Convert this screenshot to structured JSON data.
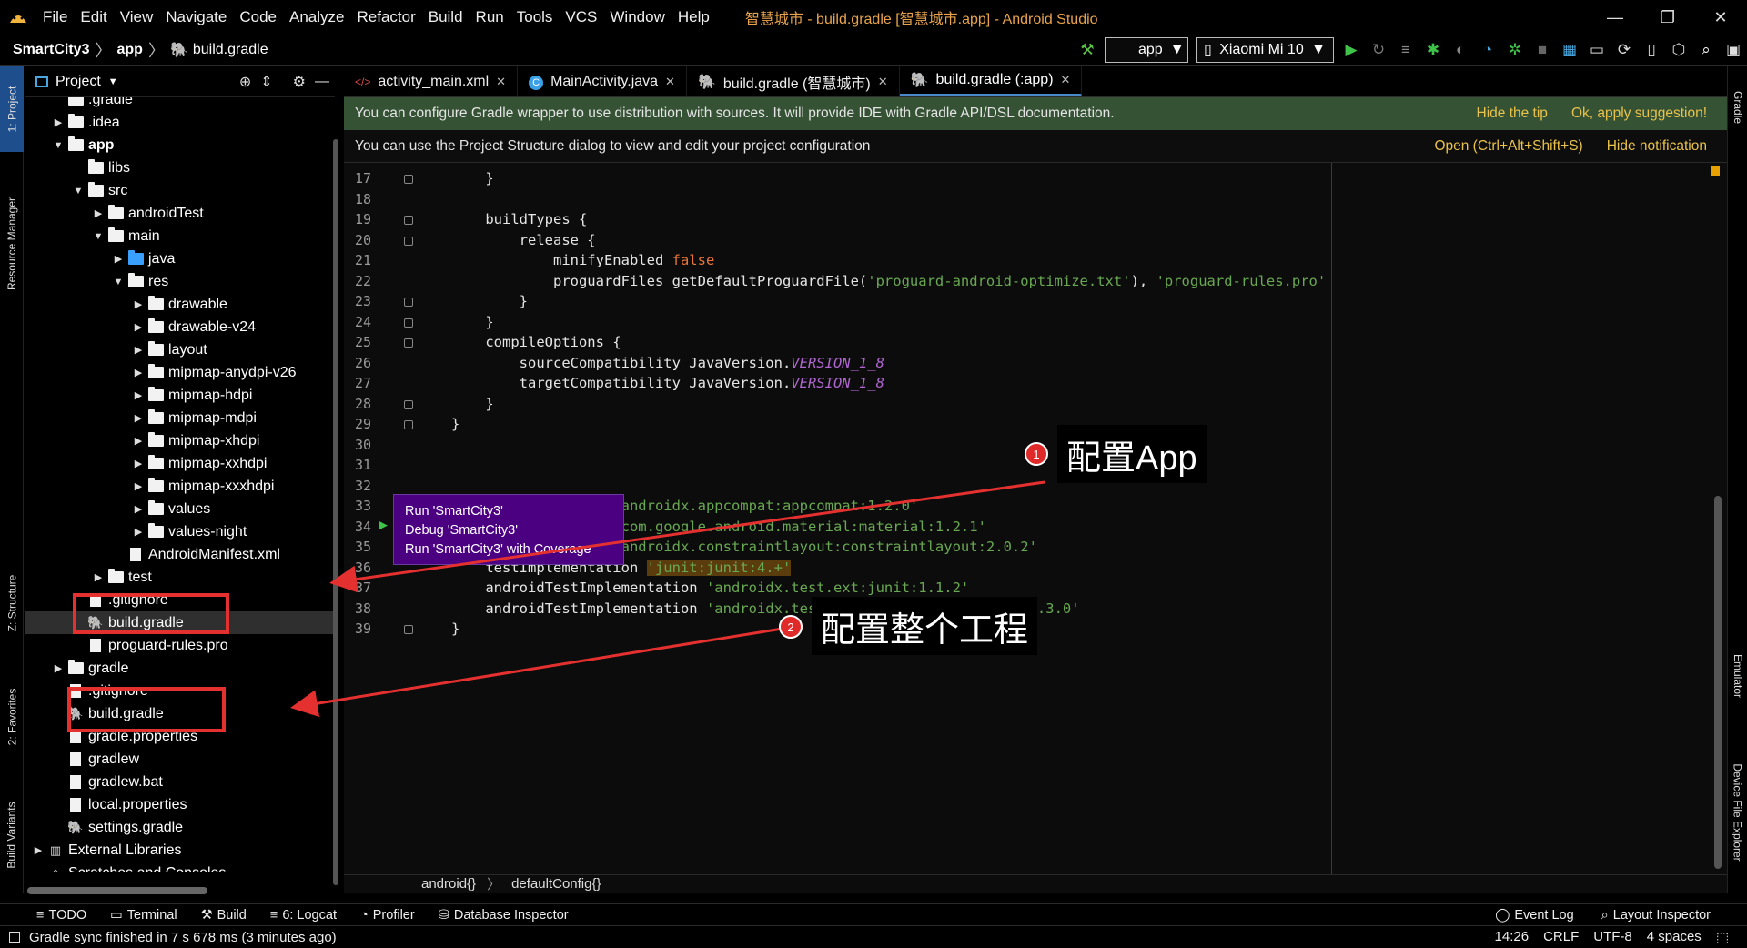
{
  "menu": {
    "items": [
      "File",
      "Edit",
      "View",
      "Navigate",
      "Code",
      "Analyze",
      "Refactor",
      "Build",
      "Run",
      "Tools",
      "VCS",
      "Window",
      "Help"
    ],
    "window_title": "智慧城市 - build.gradle [智慧城市.app] - Android Studio"
  },
  "nav": {
    "project": "SmartCity3",
    "module": "app",
    "file": "build.gradle",
    "run_config": "app",
    "device": "Xiaomi Mi 10"
  },
  "side_tabs": {
    "project": "1: Project",
    "resource_manager": "Resource Manager",
    "structure": "Z: Structure",
    "favorites": "2: Favorites",
    "build_variants": "Build Variants",
    "gradle": "Gradle",
    "emulator": "Emulator",
    "device_file_explorer": "Device File Explorer"
  },
  "project_panel": {
    "title": "Project",
    "tree": [
      {
        "label": ".gradle",
        "depth": 1,
        "arrow": "",
        "icon": "folder"
      },
      {
        "label": ".idea",
        "depth": 1,
        "arrow": "▶",
        "icon": "folder"
      },
      {
        "label": "app",
        "depth": 1,
        "arrow": "▼",
        "icon": "folder",
        "bold": true
      },
      {
        "label": "libs",
        "depth": 2,
        "arrow": "",
        "icon": "folder"
      },
      {
        "label": "src",
        "depth": 2,
        "arrow": "▼",
        "icon": "folder"
      },
      {
        "label": "androidTest",
        "depth": 3,
        "arrow": "▶",
        "icon": "folder"
      },
      {
        "label": "main",
        "depth": 3,
        "arrow": "▼",
        "icon": "folder"
      },
      {
        "label": "java",
        "depth": 4,
        "arrow": "▶",
        "icon": "folder-blue"
      },
      {
        "label": "res",
        "depth": 4,
        "arrow": "▼",
        "icon": "folder"
      },
      {
        "label": "drawable",
        "depth": 5,
        "arrow": "▶",
        "icon": "folder"
      },
      {
        "label": "drawable-v24",
        "depth": 5,
        "arrow": "▶",
        "icon": "folder"
      },
      {
        "label": "layout",
        "depth": 5,
        "arrow": "▶",
        "icon": "folder"
      },
      {
        "label": "mipmap-anydpi-v26",
        "depth": 5,
        "arrow": "▶",
        "icon": "folder"
      },
      {
        "label": "mipmap-hdpi",
        "depth": 5,
        "arrow": "▶",
        "icon": "folder"
      },
      {
        "label": "mipmap-mdpi",
        "depth": 5,
        "arrow": "▶",
        "icon": "folder"
      },
      {
        "label": "mipmap-xhdpi",
        "depth": 5,
        "arrow": "▶",
        "icon": "folder"
      },
      {
        "label": "mipmap-xxhdpi",
        "depth": 5,
        "arrow": "▶",
        "icon": "folder"
      },
      {
        "label": "mipmap-xxxhdpi",
        "depth": 5,
        "arrow": "▶",
        "icon": "folder"
      },
      {
        "label": "values",
        "depth": 5,
        "arrow": "▶",
        "icon": "folder"
      },
      {
        "label": "values-night",
        "depth": 5,
        "arrow": "▶",
        "icon": "folder"
      },
      {
        "label": "AndroidManifest.xml",
        "depth": 4,
        "arrow": "",
        "icon": "file"
      },
      {
        "label": "test",
        "depth": 3,
        "arrow": "▶",
        "icon": "folder"
      },
      {
        "label": ".gitignore",
        "depth": 2,
        "arrow": "",
        "icon": "file"
      },
      {
        "label": "build.gradle",
        "depth": 2,
        "arrow": "",
        "icon": "gradle",
        "selected": true
      },
      {
        "label": "proguard-rules.pro",
        "depth": 2,
        "arrow": "",
        "icon": "file"
      },
      {
        "label": "gradle",
        "depth": 1,
        "arrow": "▶",
        "icon": "folder"
      },
      {
        "label": ".gitignore",
        "depth": 1,
        "arrow": "",
        "icon": "file"
      },
      {
        "label": "build.gradle",
        "depth": 1,
        "arrow": "",
        "icon": "gradle"
      },
      {
        "label": "gradle.properties",
        "depth": 1,
        "arrow": "",
        "icon": "file"
      },
      {
        "label": "gradlew",
        "depth": 1,
        "arrow": "",
        "icon": "file"
      },
      {
        "label": "gradlew.bat",
        "depth": 1,
        "arrow": "",
        "icon": "file"
      },
      {
        "label": "local.properties",
        "depth": 1,
        "arrow": "",
        "icon": "file"
      },
      {
        "label": "settings.gradle",
        "depth": 1,
        "arrow": "",
        "icon": "gradle"
      },
      {
        "label": "External Libraries",
        "depth": 0,
        "arrow": "▶",
        "icon": "library"
      },
      {
        "label": "Scratches and Consoles",
        "depth": 0,
        "arrow": "",
        "icon": "scratch"
      }
    ]
  },
  "editor": {
    "tabs": [
      {
        "label": "activity_main.xml",
        "icon": "xml"
      },
      {
        "label": "MainActivity.java",
        "icon": "class"
      },
      {
        "label": "build.gradle (智慧城市)",
        "icon": "gradle"
      },
      {
        "label": "build.gradle (:app)",
        "icon": "gradle",
        "active": true
      }
    ],
    "banner1": {
      "text": "You can configure Gradle wrapper to use distribution with sources. It will provide IDE with Gradle API/DSL documentation.",
      "link1": "Hide the tip",
      "link2": "Ok, apply suggestion!"
    },
    "banner2": {
      "text": "You can use the Project Structure dialog to view and edit your project configuration",
      "link1": "Open (Ctrl+Alt+Shift+S)",
      "link2": "Hide notification"
    },
    "code": [
      {
        "n": "17",
        "html": "    }"
      },
      {
        "n": "18",
        "html": ""
      },
      {
        "n": "19",
        "html": "    buildTypes {"
      },
      {
        "n": "20",
        "html": "        release {"
      },
      {
        "n": "21",
        "html": "            minifyEnabled <span class=\"kw\">false</span>"
      },
      {
        "n": "22",
        "html": "            proguardFiles getDefaultProguardFile(<span class=\"str\">'proguard-android-optimize.txt'</span>), <span class=\"str\">'proguard-rules.pro'</span>"
      },
      {
        "n": "23",
        "html": "        }"
      },
      {
        "n": "24",
        "html": "    }"
      },
      {
        "n": "25",
        "html": "    compileOptions {"
      },
      {
        "n": "26",
        "html": "        sourceCompatibility JavaVersion.<span class=\"const\">VERSION_1_8</span>"
      },
      {
        "n": "27",
        "html": "        targetCompatibility JavaVersion.<span class=\"const\">VERSION_1_8</span>"
      },
      {
        "n": "28",
        "html": "    }"
      },
      {
        "n": "29",
        "html": "}"
      },
      {
        "n": "30",
        "html": ""
      },
      {
        "n": "31",
        "html": ""
      },
      {
        "n": "32",
        "html": ""
      },
      {
        "n": "33",
        "html": "    implementation <span class=\"str\">'androidx.appcompat:appcompat:1.2.0'</span>"
      },
      {
        "n": "34",
        "html": "    implementation <span class=\"str\">'com.google.android.material:material:1.2.1'</span>"
      },
      {
        "n": "35",
        "html": "    implementation <span class=\"str\">'androidx.constraintlayout:constraintlayout:2.0.2'</span>"
      },
      {
        "n": "36",
        "html": "    testImplementation <span class=\"hl\"><span class=\"str\">'junit:junit:4.+'</span></span>"
      },
      {
        "n": "37",
        "html": "    androidTestImplementation <span class=\"str\">'androidx.test.ext:junit:1.1.2'</span>"
      },
      {
        "n": "38",
        "html": "    androidTestImplementation <span class=\"str\">'androidx.test.espresso:espresso-core:3.3.0'</span>"
      },
      {
        "n": "39",
        "html": "}"
      }
    ],
    "run_popup": [
      "Run 'SmartCity3'",
      "Debug 'SmartCity3'",
      "Run 'SmartCity3' with Coverage"
    ],
    "breadcrumb": [
      "android{}",
      "defaultConfig{}"
    ]
  },
  "annotations": {
    "app_label": "配置App",
    "project_label": "配置整个工程",
    "badge1": "1",
    "badge2": "2"
  },
  "bottom_tools": {
    "left": [
      "TODO",
      "Terminal",
      "Build",
      "6: Logcat",
      "Profiler",
      "Database Inspector"
    ],
    "right": [
      "Event Log",
      "Layout Inspector"
    ]
  },
  "status": {
    "message": "Gradle sync finished in 7 s 678 ms (3 minutes ago)",
    "position": "14:26",
    "line_sep": "CRLF",
    "encoding": "UTF-8",
    "indent": "4 spaces"
  }
}
